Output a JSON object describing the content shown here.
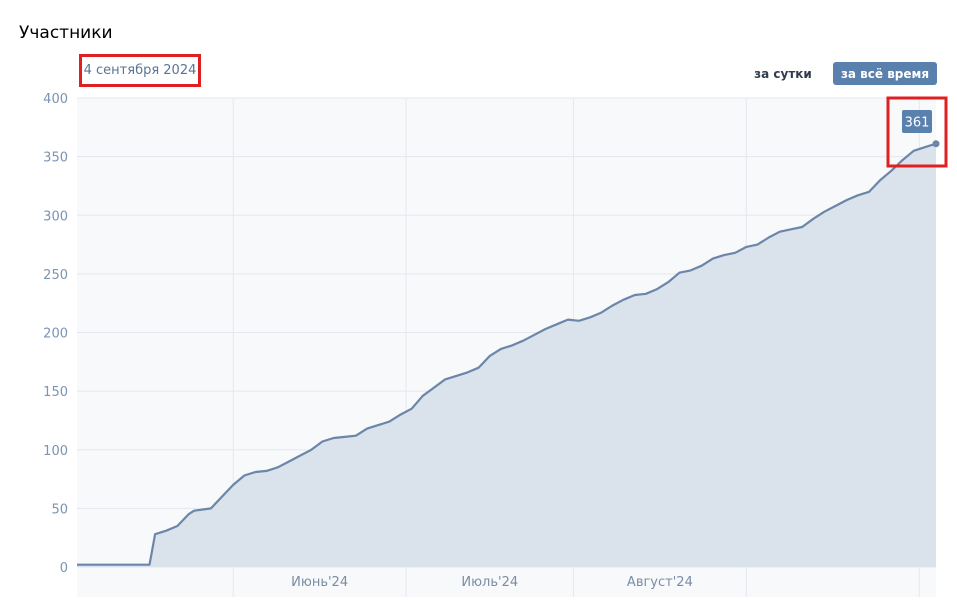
{
  "header": {
    "title": "Участники",
    "date_label": "4 сентября 2024",
    "btn_day": "за сутки",
    "btn_all": "за всё время"
  },
  "colors": {
    "line": "#6b86a9",
    "area": "#dae2eb",
    "plot_bg": "#f8f9fb",
    "grid": "#e4e8ee",
    "highlight": "#e02020",
    "badge": "#5a80ad"
  },
  "chart_data": {
    "type": "area",
    "xlabel": "",
    "ylabel": "",
    "ylim": [
      0,
      400
    ],
    "yticks": [
      0,
      50,
      100,
      150,
      200,
      250,
      300,
      350,
      400
    ],
    "xlim": [
      "2024-04-03",
      "2024-09-04"
    ],
    "month_ticks": [
      {
        "label": "Июнь'24",
        "start": "2024-05-01",
        "end": "2024-06-01"
      },
      {
        "label": "Июль'24",
        "start": "2024-06-01",
        "end": "2024-07-01"
      },
      {
        "label": "Август'24",
        "start": "2024-07-01",
        "end": "2024-08-01"
      }
    ],
    "month_boundaries": [
      "2024-05-01",
      "2024-06-01",
      "2024-07-01",
      "2024-08-01",
      "2024-09-01"
    ],
    "grid": true,
    "highlight_value": "361",
    "series": [
      {
        "x": [
          "2024-04-03",
          "2024-04-16",
          "2024-04-17",
          "2024-04-19",
          "2024-04-21",
          "2024-04-23",
          "2024-04-24",
          "2024-04-27",
          "2024-04-29",
          "2024-05-01",
          "2024-05-03",
          "2024-05-05",
          "2024-05-07",
          "2024-05-09",
          "2024-05-11",
          "2024-05-13",
          "2024-05-15",
          "2024-05-17",
          "2024-05-19",
          "2024-05-21",
          "2024-05-23",
          "2024-05-25",
          "2024-05-27",
          "2024-05-29",
          "2024-05-31",
          "2024-06-02",
          "2024-06-04",
          "2024-06-06",
          "2024-06-08",
          "2024-06-10",
          "2024-06-12",
          "2024-06-14",
          "2024-06-16",
          "2024-06-18",
          "2024-06-20",
          "2024-06-22",
          "2024-06-24",
          "2024-06-26",
          "2024-06-28",
          "2024-06-30",
          "2024-07-02",
          "2024-07-04",
          "2024-07-06",
          "2024-07-08",
          "2024-07-10",
          "2024-07-12",
          "2024-07-14",
          "2024-07-16",
          "2024-07-18",
          "2024-07-20",
          "2024-07-22",
          "2024-07-24",
          "2024-07-26",
          "2024-07-28",
          "2024-07-30",
          "2024-08-01",
          "2024-08-03",
          "2024-08-05",
          "2024-08-07",
          "2024-08-09",
          "2024-08-11",
          "2024-08-13",
          "2024-08-15",
          "2024-08-17",
          "2024-08-19",
          "2024-08-21",
          "2024-08-23",
          "2024-08-25",
          "2024-08-27",
          "2024-08-29",
          "2024-08-31",
          "2024-09-02",
          "2024-09-04"
        ],
        "y": [
          2,
          2,
          28,
          31,
          35,
          45,
          48,
          50,
          60,
          70,
          78,
          81,
          82,
          85,
          90,
          95,
          100,
          107,
          110,
          111,
          112,
          118,
          121,
          124,
          130,
          135,
          146,
          153,
          160,
          163,
          166,
          170,
          180,
          186,
          189,
          193,
          198,
          203,
          207,
          211,
          210,
          213,
          217,
          223,
          228,
          232,
          233,
          237,
          243,
          251,
          253,
          257,
          263,
          266,
          268,
          273,
          275,
          281,
          286,
          288,
          290,
          297,
          303,
          308,
          313,
          317,
          320,
          330,
          338,
          347,
          355,
          358,
          361
        ]
      }
    ]
  }
}
